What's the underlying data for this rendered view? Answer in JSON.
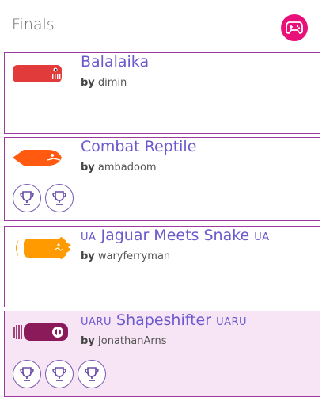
{
  "header": {
    "title": "Finals",
    "gamepad_icon": "gamepad-icon",
    "accent": "#e8117a"
  },
  "snakes": [
    {
      "name": "Balalaika",
      "prefix_tag": "",
      "suffix_tag": "",
      "by_label": "by",
      "author": "dimin",
      "color": "#e23b3b",
      "trophies": 0
    },
    {
      "name": "Combat Reptile",
      "prefix_tag": "",
      "suffix_tag": "",
      "by_label": "by",
      "author": "ambadoom",
      "color": "#ff5a0f",
      "trophies": 2
    },
    {
      "name": "Jaguar Meets Snake",
      "prefix_tag": "UA",
      "suffix_tag": "UA",
      "by_label": "by",
      "author": "waryferryman",
      "color": "#ff9b00",
      "trophies": 0
    },
    {
      "name": "Shapeshifter",
      "prefix_tag": "UARU",
      "suffix_tag": "UARU",
      "by_label": "by",
      "author": "JonathanArns",
      "color": "#8b1a5a",
      "trophies": 3
    }
  ]
}
